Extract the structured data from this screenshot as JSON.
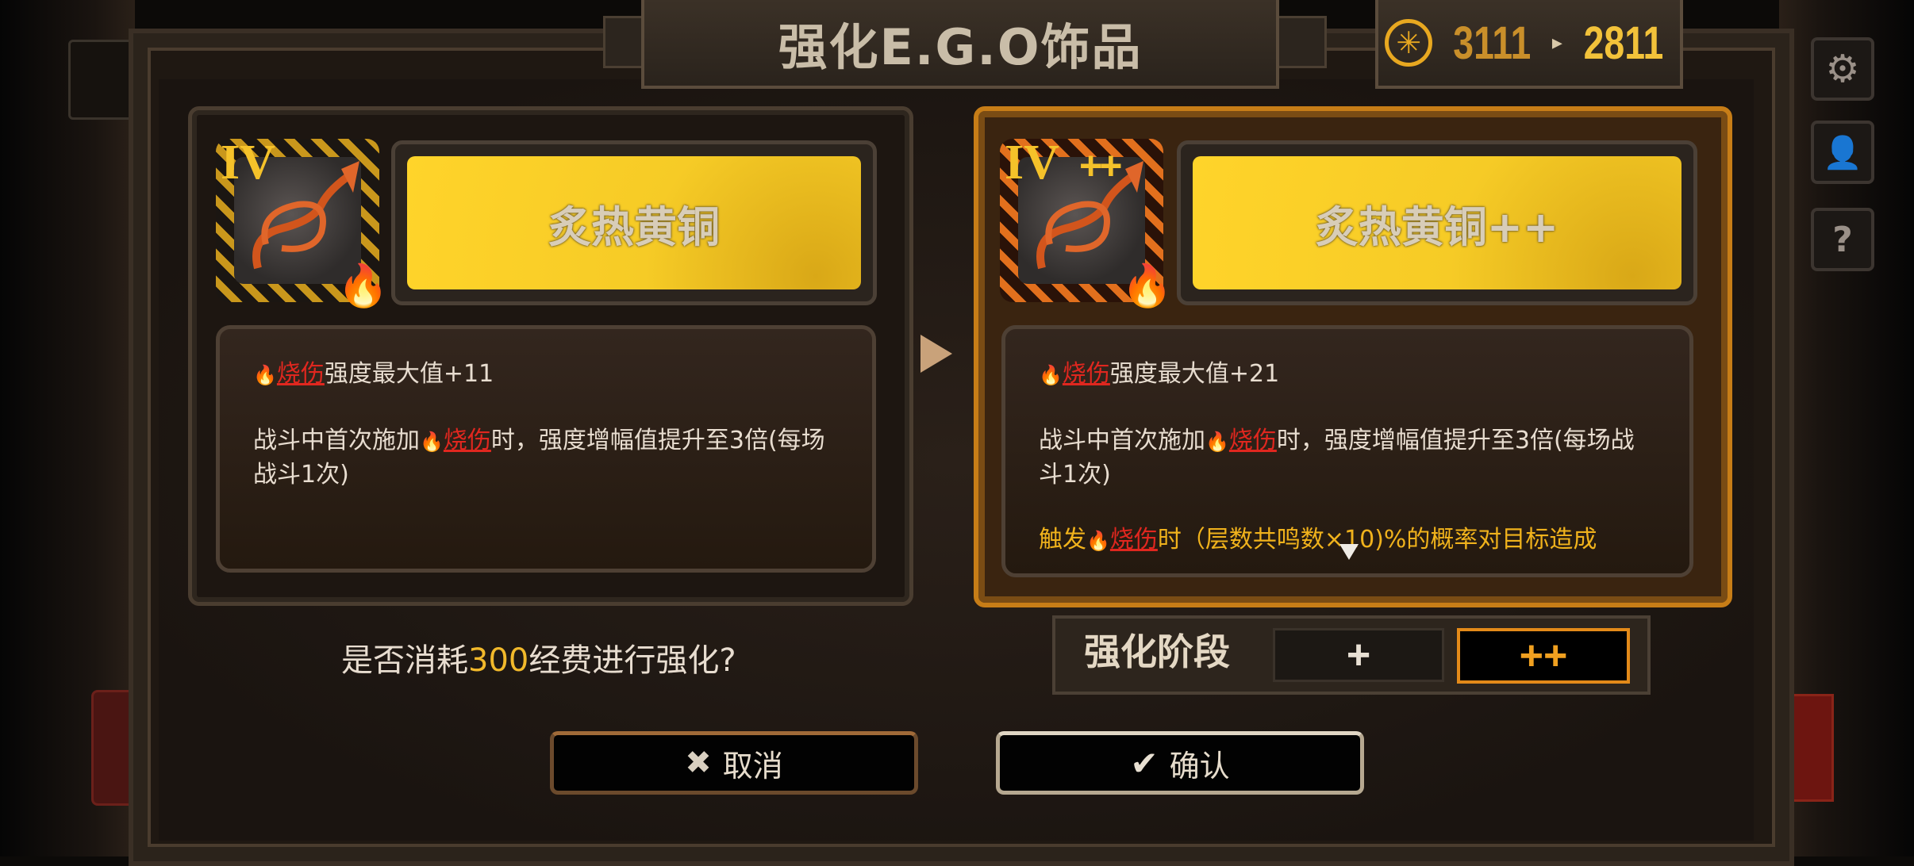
{
  "title": "强化E.G.O饰品",
  "currency": {
    "icon": "sun-coin-icon",
    "old_value": "3111",
    "arrow": "▸",
    "new_value": "2811"
  },
  "side_buttons": [
    {
      "icon": "gear-icon"
    },
    {
      "icon": "profile-icon"
    },
    {
      "icon": "help-icon"
    }
  ],
  "left_card": {
    "rank": "IV",
    "name": "炙热黄铜",
    "effect_1_prefix": "",
    "keyword": "烧伤",
    "effect_1_suffix": "强度最大值+11",
    "effect_2_a": "战斗中首次施加",
    "effect_2_b": "时，强度增幅值提升至3倍(每场战斗1次)"
  },
  "right_card": {
    "rank": "IV",
    "plus": "++",
    "name": "炙热黄铜++",
    "keyword": "烧伤",
    "effect_1_suffix": "强度最大值+21",
    "effect_2_a": "战斗中首次施加",
    "effect_2_b": "时，强度增幅值提升至3倍(每场战斗1次)",
    "effect_3_a": "触发",
    "effect_3_b": "时（层数共鸣数×10)%的概率对目标造成"
  },
  "prompt": {
    "prefix": "是否消耗",
    "amount": "300",
    "suffix": "经费进行强化?"
  },
  "stage": {
    "label": "强化阶段",
    "options": [
      "+",
      "++"
    ],
    "selected": "++"
  },
  "buttons": {
    "cancel": "取消",
    "confirm": "确认"
  },
  "colors": {
    "accent_orange": "#c77d17",
    "name_yellow": "#ffd42a",
    "burn_red": "#e0271f",
    "currency_gold": "#f2c23a"
  }
}
